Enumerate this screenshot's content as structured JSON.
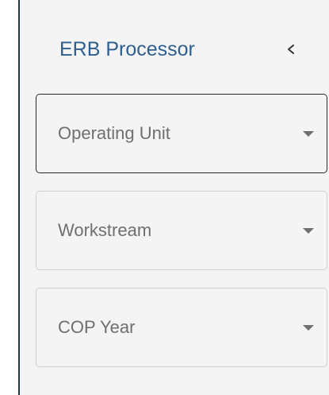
{
  "sidebar": {
    "title": "ERB Processor",
    "collapse_icon": "chevron-left-icon",
    "filters": [
      {
        "label": "Operating Unit",
        "focused": true
      },
      {
        "label": "Workstream",
        "focused": false
      },
      {
        "label": "COP Year",
        "focused": false
      }
    ]
  },
  "colors": {
    "title": "#2f5f8f",
    "label": "#6f6f6f",
    "panel_bg": "#f4f4f4",
    "left_border": "#1f3a4f"
  }
}
